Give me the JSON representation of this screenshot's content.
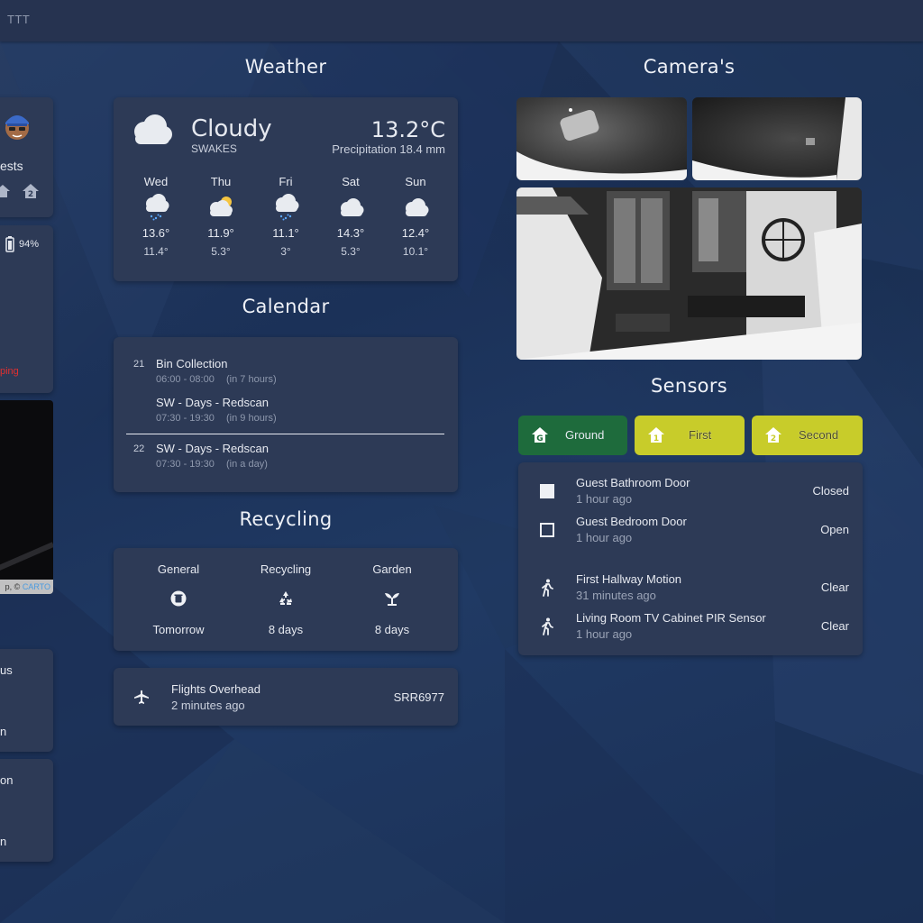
{
  "app": {
    "title": "TTT"
  },
  "sections": {
    "weather": "Weather",
    "calendar": "Calendar",
    "recycling": "Recycling",
    "cameras": "Camera's",
    "sensors": "Sensors"
  },
  "left_partial": {
    "person_label": "ests",
    "battery": "94%",
    "warning": "ping",
    "map_attr_prefix": "p, ©",
    "map_attr_link": "CARTO",
    "card3_line1": "us",
    "card3_line2": "n",
    "card4_line1": "on",
    "card4_line2": "n"
  },
  "weather": {
    "condition": "Cloudy",
    "location": "SWAKES",
    "temperature": "13.2°C",
    "precipitation": "Precipitation 18.4 mm",
    "icon": "cloud-icon",
    "forecast": [
      {
        "day": "Wed",
        "icon": "rain-cloud-icon",
        "high": "13.6°",
        "low": "11.4°"
      },
      {
        "day": "Thu",
        "icon": "partly-sunny-icon",
        "high": "11.9°",
        "low": "5.3°"
      },
      {
        "day": "Fri",
        "icon": "rain-cloud-icon",
        "high": "11.1°",
        "low": "3°"
      },
      {
        "day": "Sat",
        "icon": "cloud-icon",
        "high": "14.3°",
        "low": "5.3°"
      },
      {
        "day": "Sun",
        "icon": "cloud-icon",
        "high": "12.4°",
        "low": "10.1°"
      }
    ]
  },
  "calendar": {
    "events": [
      {
        "day": "21",
        "title": "Bin Collection",
        "time": "06:00 - 08:00",
        "rel": "(in 7 hours)"
      },
      {
        "day": "",
        "title": "SW - Days - Redscan",
        "time": "07:30 - 19:30",
        "rel": "(in 9 hours)"
      },
      {
        "day": "22",
        "title": "SW - Days - Redscan",
        "time": "07:30 - 19:30",
        "rel": "(in a day)"
      }
    ]
  },
  "recycling": {
    "columns": [
      {
        "label": "General",
        "icon": "bin-icon",
        "value": "Tomorrow"
      },
      {
        "label": "Recycling",
        "icon": "recycle-icon",
        "value": "8 days"
      },
      {
        "label": "Garden",
        "icon": "sprout-icon",
        "value": "8 days"
      }
    ]
  },
  "flights": {
    "title": "Flights Overhead",
    "time": "2 minutes ago",
    "callsign": "SRR6977",
    "icon": "airplane-icon"
  },
  "sensors": {
    "floors": [
      {
        "label": "Ground",
        "color": "#1e6b3c",
        "icon": "home-g-icon"
      },
      {
        "label": "First",
        "color": "#c8cc2a",
        "icon": "home-1-icon"
      },
      {
        "label": "Second",
        "color": "#c8cc2a",
        "icon": "home-2-icon"
      }
    ],
    "items": [
      {
        "name": "Guest Bathroom Door",
        "time": "1 hour ago",
        "state": "Closed",
        "icon": "door-closed-icon"
      },
      {
        "name": "Guest Bedroom Door",
        "time": "1 hour ago",
        "state": "Open",
        "icon": "door-open-icon"
      },
      {
        "name": "First Hallway Motion",
        "time": "31 minutes ago",
        "state": "Clear",
        "icon": "walk-icon"
      },
      {
        "name": "Living Room TV Cabinet PIR Sensor",
        "time": "1 hour ago",
        "state": "Clear",
        "icon": "walk-icon"
      }
    ]
  },
  "colors": {
    "card": "#2d3a56",
    "accent_green": "#1e6b3c",
    "accent_yellow": "#c8cc2a",
    "warning_red": "#e03030",
    "carto_blue": "#4a9be0"
  }
}
